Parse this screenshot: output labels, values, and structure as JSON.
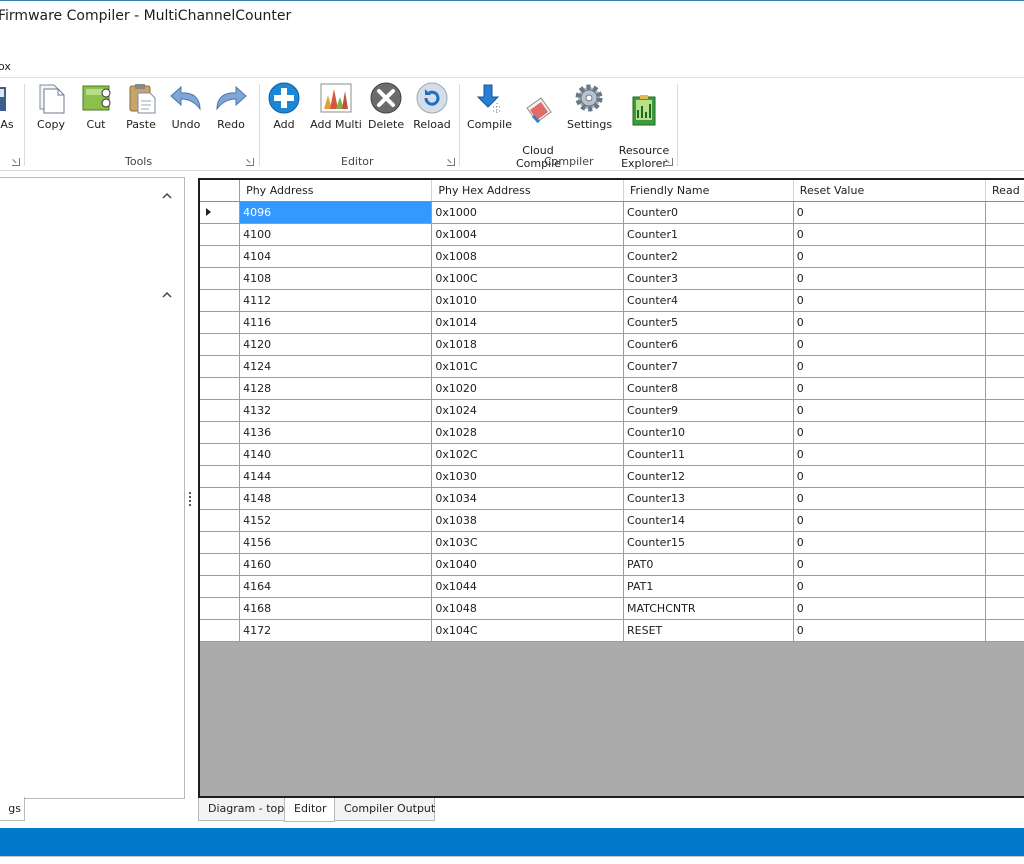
{
  "window": {
    "title": "Firmware Compiler - MultiChannelCounter"
  },
  "menu": {
    "visible_item": "ox"
  },
  "ribbon": {
    "buttons": [
      {
        "key": "save_as",
        "label": "As",
        "icon": "save-as-icon"
      },
      {
        "key": "copy",
        "label": "Copy",
        "icon": "copy-icon"
      },
      {
        "key": "cut",
        "label": "Cut",
        "icon": "cut-icon"
      },
      {
        "key": "paste",
        "label": "Paste",
        "icon": "paste-icon"
      },
      {
        "key": "undo",
        "label": "Undo",
        "icon": "undo-icon"
      },
      {
        "key": "redo",
        "label": "Redo",
        "icon": "redo-icon"
      },
      {
        "key": "add",
        "label": "Add",
        "icon": "add-icon"
      },
      {
        "key": "add_multi",
        "label": "Add Multi",
        "icon": "add-multi-icon"
      },
      {
        "key": "delete",
        "label": "Delete",
        "icon": "delete-icon"
      },
      {
        "key": "reload",
        "label": "Reload",
        "icon": "reload-icon"
      },
      {
        "key": "compile",
        "label": "Compile",
        "icon": "compile-icon"
      },
      {
        "key": "cloud_compile",
        "label": "Cloud\nCompile",
        "icon": "cloud-compile-icon"
      },
      {
        "key": "settings",
        "label": "Settings",
        "icon": "settings-icon"
      },
      {
        "key": "resource_explorer",
        "label": "Resource\nExplorer",
        "icon": "resource-explorer-icon"
      }
    ],
    "groups": {
      "tools": "Tools",
      "editor": "Editor",
      "compiler": "Compiler"
    }
  },
  "left_panel": {
    "tab_label": "gs"
  },
  "grid": {
    "columns": [
      "Phy Address",
      "Phy Hex Address",
      "Friendly Name",
      "Reset Value",
      "Read"
    ],
    "selected_row": 0,
    "rows": [
      [
        "4096",
        "0x1000",
        "Counter0",
        "0"
      ],
      [
        "4100",
        "0x1004",
        "Counter1",
        "0"
      ],
      [
        "4104",
        "0x1008",
        "Counter2",
        "0"
      ],
      [
        "4108",
        "0x100C",
        "Counter3",
        "0"
      ],
      [
        "4112",
        "0x1010",
        "Counter4",
        "0"
      ],
      [
        "4116",
        "0x1014",
        "Counter5",
        "0"
      ],
      [
        "4120",
        "0x1018",
        "Counter6",
        "0"
      ],
      [
        "4124",
        "0x101C",
        "Counter7",
        "0"
      ],
      [
        "4128",
        "0x1020",
        "Counter8",
        "0"
      ],
      [
        "4132",
        "0x1024",
        "Counter9",
        "0"
      ],
      [
        "4136",
        "0x1028",
        "Counter10",
        "0"
      ],
      [
        "4140",
        "0x102C",
        "Counter11",
        "0"
      ],
      [
        "4144",
        "0x1030",
        "Counter12",
        "0"
      ],
      [
        "4148",
        "0x1034",
        "Counter13",
        "0"
      ],
      [
        "4152",
        "0x1038",
        "Counter14",
        "0"
      ],
      [
        "4156",
        "0x103C",
        "Counter15",
        "0"
      ],
      [
        "4160",
        "0x1040",
        "PAT0",
        "0"
      ],
      [
        "4164",
        "0x1044",
        "PAT1",
        "0"
      ],
      [
        "4168",
        "0x1048",
        "MATCHCNTR",
        "0"
      ],
      [
        "4172",
        "0x104C",
        "RESET",
        "0"
      ]
    ]
  },
  "doc_tabs": [
    {
      "label": "Diagram - top",
      "active": false
    },
    {
      "label": "Editor",
      "active": true
    },
    {
      "label": "Compiler Output",
      "active": false
    }
  ],
  "colors": {
    "selection": "#3399ff",
    "status_bar": "#0079cc",
    "grid_empty": "#ababab"
  }
}
